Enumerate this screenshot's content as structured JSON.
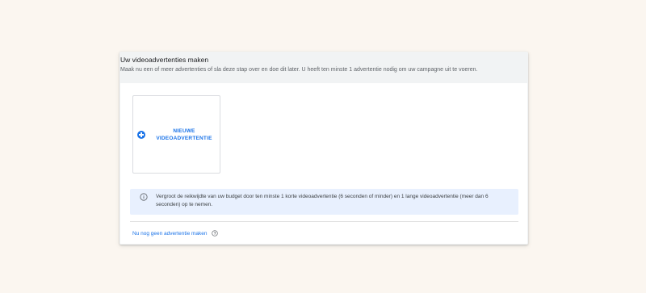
{
  "section": {
    "title": "Uw videoadvertenties maken",
    "description": "Maak nu een of meer advertenties of sla deze stap over en doe dit later. U heeft ten minste 1 advertentie nodig om uw campagne uit te voeren."
  },
  "new_ad_tile": {
    "label_line1": "NIEUWE",
    "label_line2": "VIDEOADVERTENTIE",
    "icon": "add-circle-icon"
  },
  "info": {
    "icon": "info-icon",
    "text": "Vergroot de reikwijdte van uw budget door ten minste 1 korte videoadvertentie (6 seconden of minder) en 1 lange videoadvertentie (meer dan 6 seconden) op te nemen."
  },
  "skip": {
    "link_label": "Nu nog geen advertentie maken",
    "help_icon": "help-icon"
  },
  "colors": {
    "accent": "#1a73e8",
    "background": "#fbf6f0",
    "info_bg": "#e8f0fe"
  }
}
